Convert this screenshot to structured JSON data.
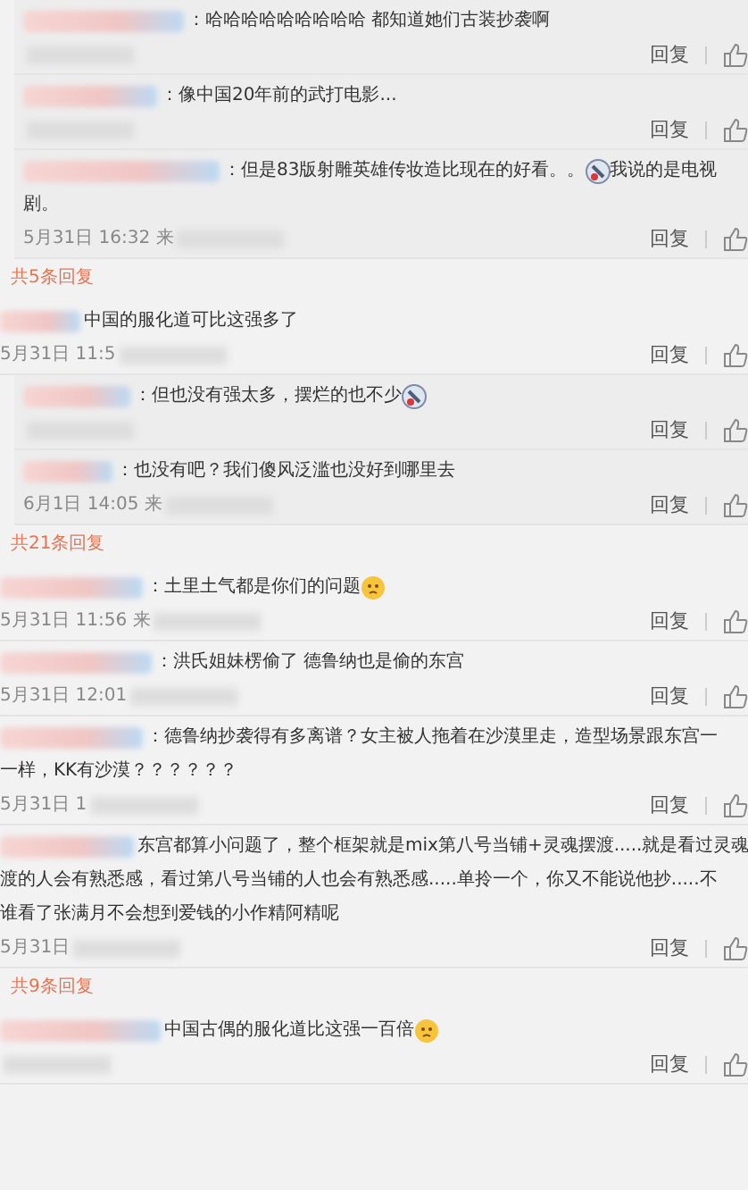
{
  "comments": [
    {
      "kind": "comment",
      "nested": true,
      "segments": [
        {
          "kind": "text",
          "text": "：哈哈哈哈哈哈哈哈哈 都知道她们古装抄袭啊"
        }
      ],
      "reply": "回复"
    },
    {
      "kind": "comment",
      "nested": true,
      "segments": [
        {
          "kind": "text",
          "text": "：像中国20年前的武打电影..."
        }
      ],
      "reply": "回复"
    },
    {
      "kind": "comment",
      "nested": true,
      "segments": [
        {
          "kind": "text",
          "text": "：但是83版射雕英雄传妆造比现在的好看。。"
        },
        {
          "kind": "sticker"
        },
        {
          "kind": "text",
          "text": "我说的是电视"
        }
      ],
      "lines": [
        "剧。"
      ],
      "date": "5月31日 16:32 来",
      "reply": "回复"
    },
    {
      "kind": "more",
      "text": "共5条回复"
    },
    {
      "kind": "comment",
      "nested": false,
      "segments": [
        {
          "kind": "text",
          "text": "中国的服化道可比这强多了"
        }
      ],
      "date": "5月31日 11:5",
      "reply": "回复"
    },
    {
      "kind": "comment",
      "nested": true,
      "segments": [
        {
          "kind": "text",
          "text": "：但也没有强太多，摆烂的也不少"
        },
        {
          "kind": "sticker"
        }
      ],
      "reply": "回复"
    },
    {
      "kind": "comment",
      "nested": true,
      "segments": [
        {
          "kind": "text",
          "text": "：也没有吧？我们傻风泛滥也没好到哪里去"
        }
      ],
      "date": "6月1日 14:05 来",
      "reply": "回复"
    },
    {
      "kind": "more",
      "text": "共21条回复"
    },
    {
      "kind": "comment",
      "nested": false,
      "segments": [
        {
          "kind": "text",
          "text": "：土里土气都是你们的问题"
        },
        {
          "kind": "emoji"
        }
      ],
      "date": "5月31日 11:56 来",
      "reply": "回复"
    },
    {
      "kind": "comment",
      "nested": false,
      "segments": [
        {
          "kind": "text",
          "text": "：洪氏姐妹楞偷了 德鲁纳也是偷的东宫"
        }
      ],
      "date": "5月31日 12:01",
      "reply": "回复"
    },
    {
      "kind": "comment",
      "nested": false,
      "segments": [
        {
          "kind": "text",
          "text": "：德鲁纳抄袭得有多离谱？女主被人拖着在沙漠里走，造型场景跟东宫一"
        }
      ],
      "lines": [
        "一样，KK有沙漠？？？？？？"
      ],
      "date": "5月31日 1",
      "reply": "回复"
    },
    {
      "kind": "comment",
      "nested": false,
      "segments": [
        {
          "kind": "text",
          "text": "东宫都算小问题了，整个框架就是mix第八号当铺+灵魂摆渡.....就是看过灵魂"
        }
      ],
      "lines": [
        "渡的人会有熟悉感，看过第八号当铺的人也会有熟悉感.....单拎一个，你又不能说他抄.....不",
        "谁看了张满月不会想到爱钱的小作精阿精呢"
      ],
      "date": "5月31日",
      "reply": "回复"
    },
    {
      "kind": "more",
      "text": "共9条回复"
    },
    {
      "kind": "comment",
      "nested": false,
      "segments": [
        {
          "kind": "text",
          "text": "中国古偶的服化道比这强一百倍"
        },
        {
          "kind": "emoji"
        }
      ],
      "reply": "回复"
    }
  ]
}
